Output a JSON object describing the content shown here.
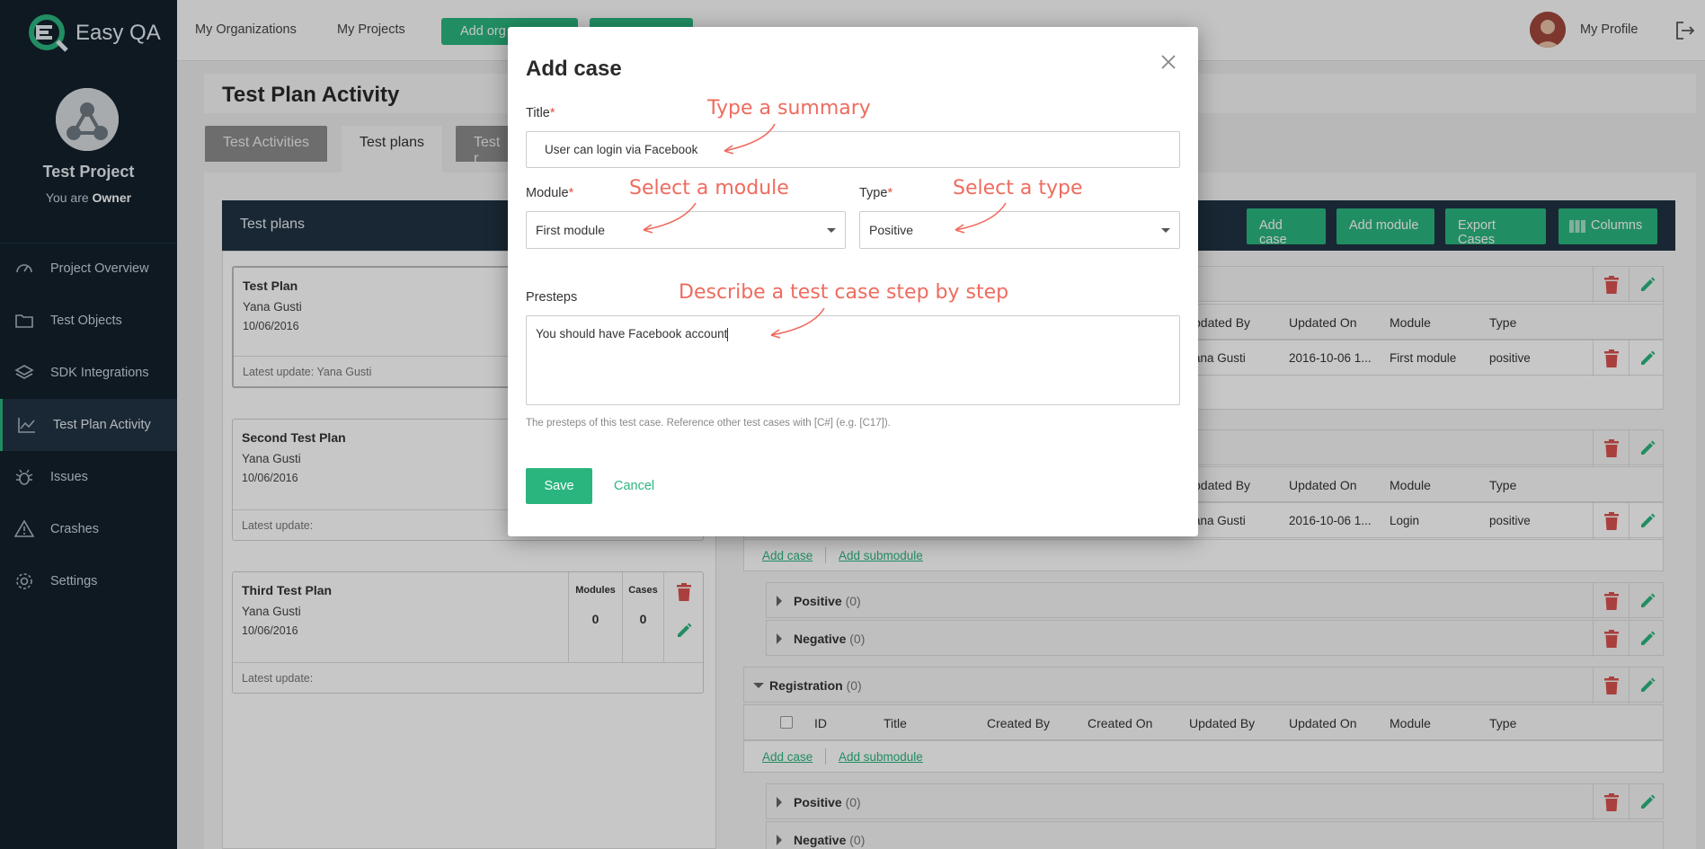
{
  "brand": {
    "name": "Easy QA"
  },
  "project": {
    "name": "Test Project",
    "role_prefix": "You are",
    "role": "Owner"
  },
  "nav": [
    {
      "label": "Project Overview",
      "icon": "speedometer-icon"
    },
    {
      "label": "Test Objects",
      "icon": "folder-icon"
    },
    {
      "label": "SDK Integrations",
      "icon": "layers-icon"
    },
    {
      "label": "Test Plan Activity",
      "icon": "chart-line-icon",
      "active": true
    },
    {
      "label": "Issues",
      "icon": "bug-icon"
    },
    {
      "label": "Crashes",
      "icon": "warning-icon"
    },
    {
      "label": "Settings",
      "icon": "gear-icon"
    }
  ],
  "topbar": {
    "links": [
      "My Organizations",
      "My Projects"
    ],
    "buttons": [
      "Add org",
      ""
    ],
    "profile": "My Profile"
  },
  "page": {
    "title": "Test Plan Activity"
  },
  "tabs": [
    "Test Activities",
    "Test plans",
    "Test r"
  ],
  "panel": {
    "title": "Test plans",
    "buttons": [
      "Add case",
      "Add module",
      "Export Cases",
      "Columns"
    ]
  },
  "plans": [
    {
      "title": "Test Plan",
      "author": "Yana Gusti",
      "date": "10/06/2016",
      "footer": "Latest update: Yana Gusti"
    },
    {
      "title": "Second Test Plan",
      "author": "Yana Gusti",
      "date": "10/06/2016",
      "footer": "Latest update:"
    },
    {
      "title": "Third Test Plan",
      "author": "Yana Gusti",
      "date": "10/06/2016",
      "footer": "Latest update:",
      "modules_label": "Modules",
      "cases_label": "Cases",
      "modules": "0",
      "cases": "0"
    }
  ],
  "table": {
    "headers_partial": [
      "pdated By",
      "Updated On",
      "Module",
      "Type"
    ],
    "row1": [
      "ana Gusti",
      "2016-10-06 1...",
      "First module",
      "positive"
    ],
    "row2": [
      "ana Gusti",
      "2016-10-06 1...",
      "Login",
      "positive"
    ],
    "full_headers": [
      "ID",
      "Title",
      "Created By",
      "Created On",
      "Updated By",
      "Updated On",
      "Module",
      "Type"
    ]
  },
  "modules": {
    "add_case": "Add case",
    "add_submodule": "Add submodule",
    "positive": "Positive",
    "negative": "Negative",
    "registration": "Registration",
    "zero": "(0)"
  },
  "modal": {
    "title": "Add case",
    "title_label": "Title",
    "title_value": "User can login via Facebook",
    "module_label": "Module",
    "module_value": "First module",
    "type_label": "Type",
    "type_value": "Positive",
    "presteps_label": "Presteps",
    "presteps_value": "You should have Facebook account",
    "hint": "The presteps of this test case. Reference other test cases with [C#] (e.g. [C17]).",
    "save": "Save",
    "cancel": "Cancel",
    "required_mark": "*"
  },
  "annotations": {
    "summary": "Type a summary",
    "module": "Select a module",
    "type": "Select a type",
    "steps": "Describe a test case step by step"
  },
  "colors": {
    "accent": "#2bb57e",
    "sidebar": "#12202c",
    "annotation": "#ef6b5f",
    "danger": "#d9534f"
  }
}
